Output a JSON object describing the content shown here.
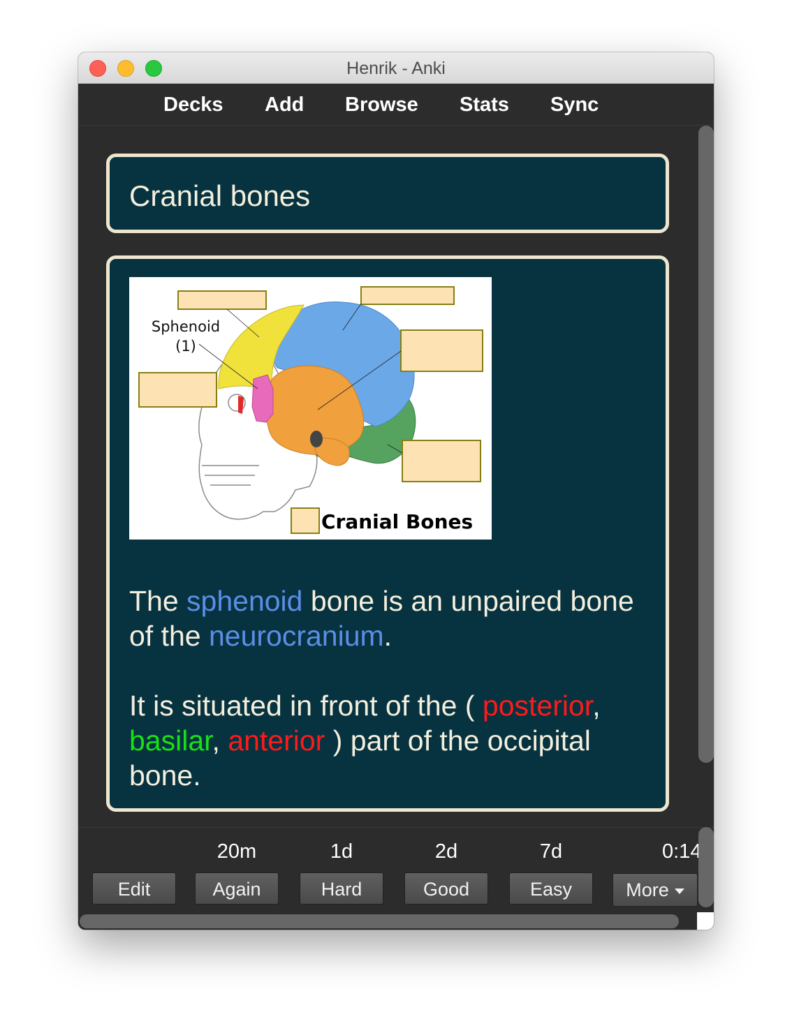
{
  "window": {
    "title": "Henrik - Anki"
  },
  "toolbar": {
    "decks": "Decks",
    "add": "Add",
    "browse": "Browse",
    "stats": "Stats",
    "sync": "Sync"
  },
  "card": {
    "front": "Cranial bones",
    "image": {
      "label_sphenoid": "Sphenoid",
      "label_number": "(1)",
      "caption": "Cranial Bones"
    },
    "answer": {
      "p1_a": "The ",
      "p1_sphenoid": "sphenoid",
      "p1_b": " bone is an unpaired bone of the ",
      "p1_neuro": "neurocranium",
      "p1_c": ".",
      "p2_a": "It is situated in front of the ( ",
      "p2_posterior": "posterior",
      "p2_b": ", ",
      "p2_basilar": "basilar",
      "p2_c": ", ",
      "p2_anterior": "anterior",
      "p2_d": " ) part of the occipital bone."
    }
  },
  "answer_bar": {
    "intervals": {
      "again": "20m",
      "hard": "1d",
      "good": "2d",
      "easy": "7d"
    },
    "timer": "0:14",
    "buttons": {
      "edit": "Edit",
      "again": "Again",
      "hard": "Hard",
      "good": "Good",
      "easy": "Easy",
      "more": "More"
    }
  },
  "colors": {
    "card_bg": "#073340",
    "card_border": "#eee6cf",
    "highlight_blue": "#5b8ee6",
    "highlight_red": "#ff1a1a",
    "highlight_green": "#18e018"
  }
}
